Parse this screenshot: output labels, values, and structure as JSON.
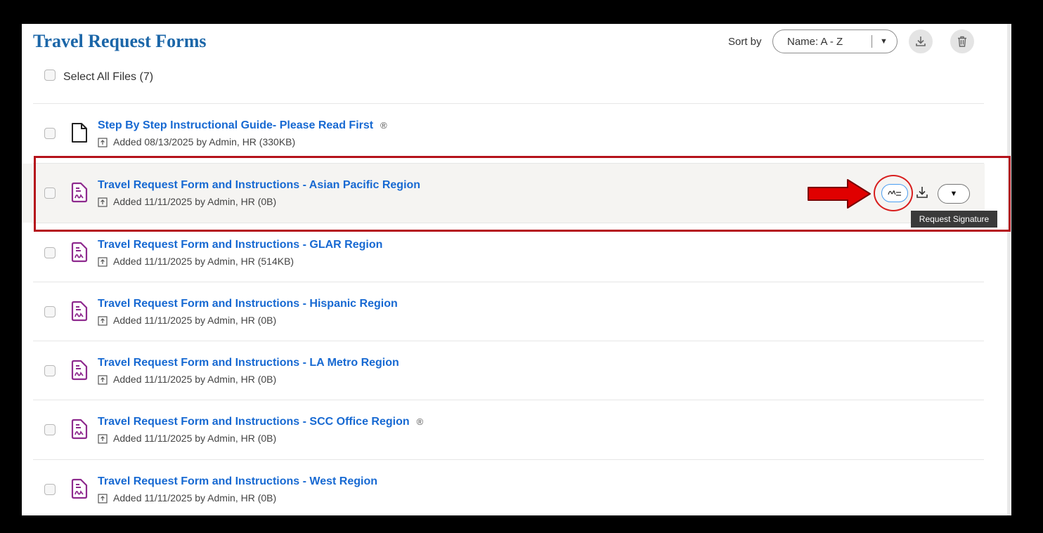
{
  "page": {
    "title": "Travel Request Forms"
  },
  "toolbar": {
    "sort_label": "Sort by",
    "sort_value": "Name: A - Z",
    "download_icon": "download-icon",
    "delete_icon": "trash-icon"
  },
  "select_all": {
    "label": "Select All Files (7)"
  },
  "files": [
    {
      "name": "Step By Step Instructional Guide- Please Read First",
      "meta": "Added 08/13/2025 by Admin, HR (330KB)",
      "type": "document",
      "owner_icon": true
    },
    {
      "name": "Travel Request Form and Instructions - Asian Pacific Region",
      "meta": "Added 11/11/2025 by Admin, HR (0B)",
      "type": "signable-form",
      "owner_icon": false
    },
    {
      "name": "Travel Request Form and Instructions - GLAR Region",
      "meta": "Added 11/11/2025 by Admin, HR (514KB)",
      "type": "signable-form",
      "owner_icon": false
    },
    {
      "name": "Travel Request Form and Instructions - Hispanic Region",
      "meta": "Added 11/11/2025 by Admin, HR (0B)",
      "type": "signable-form",
      "owner_icon": false
    },
    {
      "name": "Travel Request Form and Instructions - LA Metro Region",
      "meta": "Added 11/11/2025 by Admin, HR (0B)",
      "type": "signable-form",
      "owner_icon": false
    },
    {
      "name": "Travel Request Form and Instructions - SCC Office Region",
      "meta": "Added 11/11/2025 by Admin, HR (0B)",
      "type": "signable-form",
      "owner_icon": true
    },
    {
      "name": "Travel Request Form and Instructions - West Region",
      "meta": "Added 11/11/2025 by Admin, HR (0B)",
      "type": "signable-form",
      "owner_icon": false
    }
  ],
  "row_actions": {
    "tooltip": "Request Signature"
  },
  "colors": {
    "link": "#1769d2",
    "title": "#1b66a8",
    "form_icon": "#8e2a8e",
    "highlight_border": "#b5121b",
    "arrow": "#e00000"
  }
}
